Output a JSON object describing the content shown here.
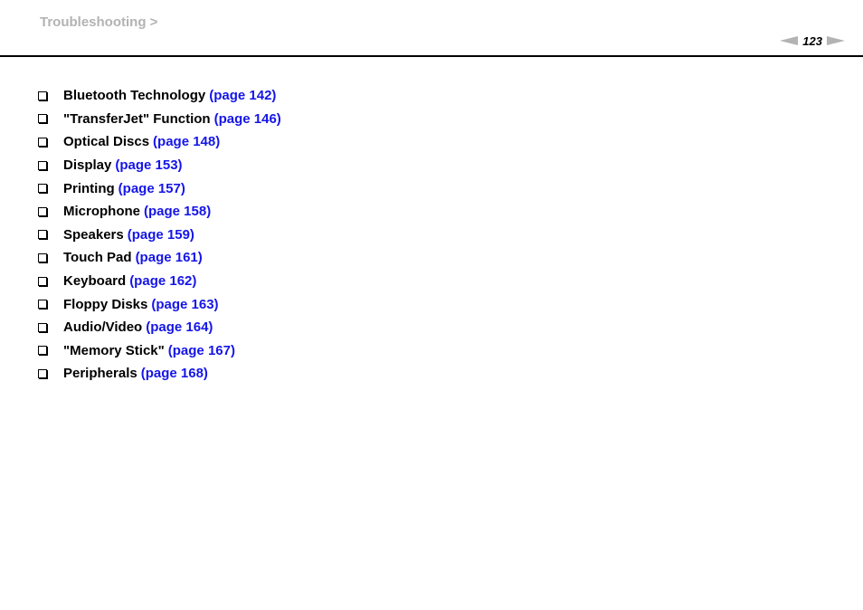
{
  "header": {
    "breadcrumb": "Troubleshooting >",
    "page_number": "123"
  },
  "colors": {
    "link": "#1515e8",
    "breadcrumb": "#b3b3b3",
    "text": "#000000"
  },
  "toc": {
    "items": [
      {
        "title": "Bluetooth Technology",
        "link": "(page 142)",
        "icon": "checkbox-icon"
      },
      {
        "title": "\"TransferJet\" Function",
        "link": "(page 146)",
        "icon": "checkbox-icon"
      },
      {
        "title": "Optical Discs",
        "link": "(page 148)",
        "icon": "checkbox-icon"
      },
      {
        "title": "Display",
        "link": "(page 153)",
        "icon": "checkbox-icon"
      },
      {
        "title": "Printing",
        "link": "(page 157)",
        "icon": "checkbox-icon"
      },
      {
        "title": "Microphone",
        "link": "(page 158)",
        "icon": "checkbox-icon"
      },
      {
        "title": "Speakers",
        "link": "(page 159)",
        "icon": "checkbox-icon"
      },
      {
        "title": "Touch Pad",
        "link": "(page 161)",
        "icon": "checkbox-icon"
      },
      {
        "title": "Keyboard",
        "link": "(page 162)",
        "icon": "checkbox-icon"
      },
      {
        "title": "Floppy Disks",
        "link": "(page 163)",
        "icon": "checkbox-icon"
      },
      {
        "title": "Audio/Video",
        "link": "(page 164)",
        "icon": "checkbox-icon"
      },
      {
        "title": "\"Memory Stick\"",
        "link": "(page 167)",
        "icon": "checkbox-icon"
      },
      {
        "title": "Peripherals",
        "link": "(page 168)",
        "icon": "checkbox-icon"
      }
    ]
  }
}
